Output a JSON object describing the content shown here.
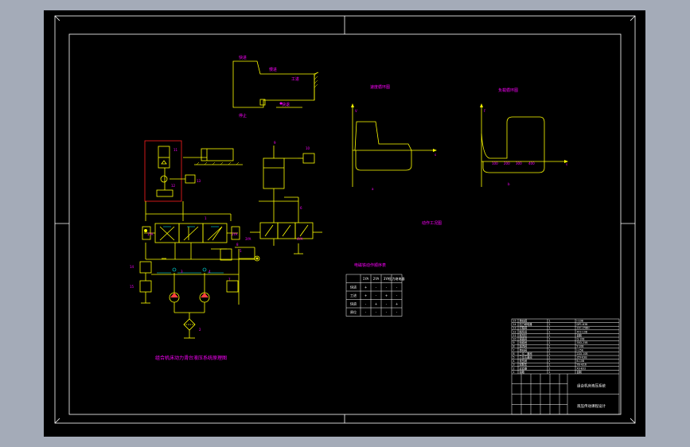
{
  "colors": {
    "background": "#000000",
    "frame": "#ffffff",
    "circuit": "#ffff00",
    "label": "#ff00ff",
    "valve_detail": "#00ffff",
    "component_box": "#ff2020",
    "title_block": "#ffffff",
    "workspace": "#a4abb8"
  },
  "drawing": {
    "cycle_labels": {
      "fast_forward": "快进",
      "work_feed": "工进",
      "fast_return": "快退",
      "slow": "慢进",
      "stop": "停止"
    },
    "circuit_title": "组合机床动力滑台液压系统原理图",
    "working_diagram_title": "动作工况图",
    "action_table": {
      "title": "电磁铁动作顺序表",
      "headers": [
        "",
        "1YA",
        "2YA",
        "3YA",
        "压力继电器"
      ],
      "rows": [
        [
          "快进",
          "+",
          "-",
          "-",
          "-"
        ],
        [
          "工进",
          "+",
          "-",
          "+",
          "-"
        ],
        [
          "快退",
          "-",
          "+",
          "-",
          "+"
        ],
        [
          "原位",
          "-",
          "-",
          "-",
          "-"
        ]
      ]
    },
    "speed_chart": {
      "title": "速度循环图",
      "ylabel": "V",
      "xlabel": "s",
      "caption": "a"
    },
    "load_chart": {
      "title": "负载循环图",
      "ylabel": "F",
      "xlabel": "s",
      "ticks": [
        "100",
        "200",
        "300",
        "400"
      ],
      "caption": "b"
    },
    "component_numbers": [
      "1",
      "2",
      "3",
      "4",
      "5",
      "6",
      "7",
      "8",
      "9",
      "10",
      "11",
      "12",
      "13",
      "14",
      "15"
    ],
    "valve_labels": {
      "v1ya": "1YA",
      "v2ya": "2YA",
      "v3ya": "3YA",
      "v4ya": "4YA"
    }
  },
  "title_block": {
    "parts": [
      [
        "15",
        "单向阀",
        "1",
        "I-10B"
      ],
      [
        "14",
        "压力继电器",
        "1",
        "DP1-63B"
      ],
      [
        "13",
        "行程阀",
        "1",
        "22C-25BH"
      ],
      [
        "12",
        "顺序阀",
        "1",
        "XF3-10B"
      ],
      [
        "11",
        "液压缸",
        "1",
        "自制"
      ],
      [
        "10",
        "调速阀",
        "1",
        "Q-10B"
      ],
      [
        "9",
        "电磁阀",
        "1",
        "35D-25B"
      ],
      [
        "8",
        "溢流阀",
        "1",
        "Y-10B"
      ],
      [
        "7",
        "单向阀",
        "2",
        "I-25B"
      ],
      [
        "6",
        "二位二通阀",
        "1",
        "22D-10B"
      ],
      [
        "5",
        "三位五通阀",
        "1",
        "35Y-63B"
      ],
      [
        "4",
        "背压阀",
        "1",
        "B-10B"
      ],
      [
        "3",
        "双联泵",
        "1",
        "YB-4/16"
      ],
      [
        "2",
        "过滤器",
        "1",
        "XU-B32"
      ],
      [
        "1",
        "油箱",
        "1",
        "自制"
      ]
    ],
    "drawing_name": "组合机床液压系统",
    "school": "液压传动课程设计"
  }
}
